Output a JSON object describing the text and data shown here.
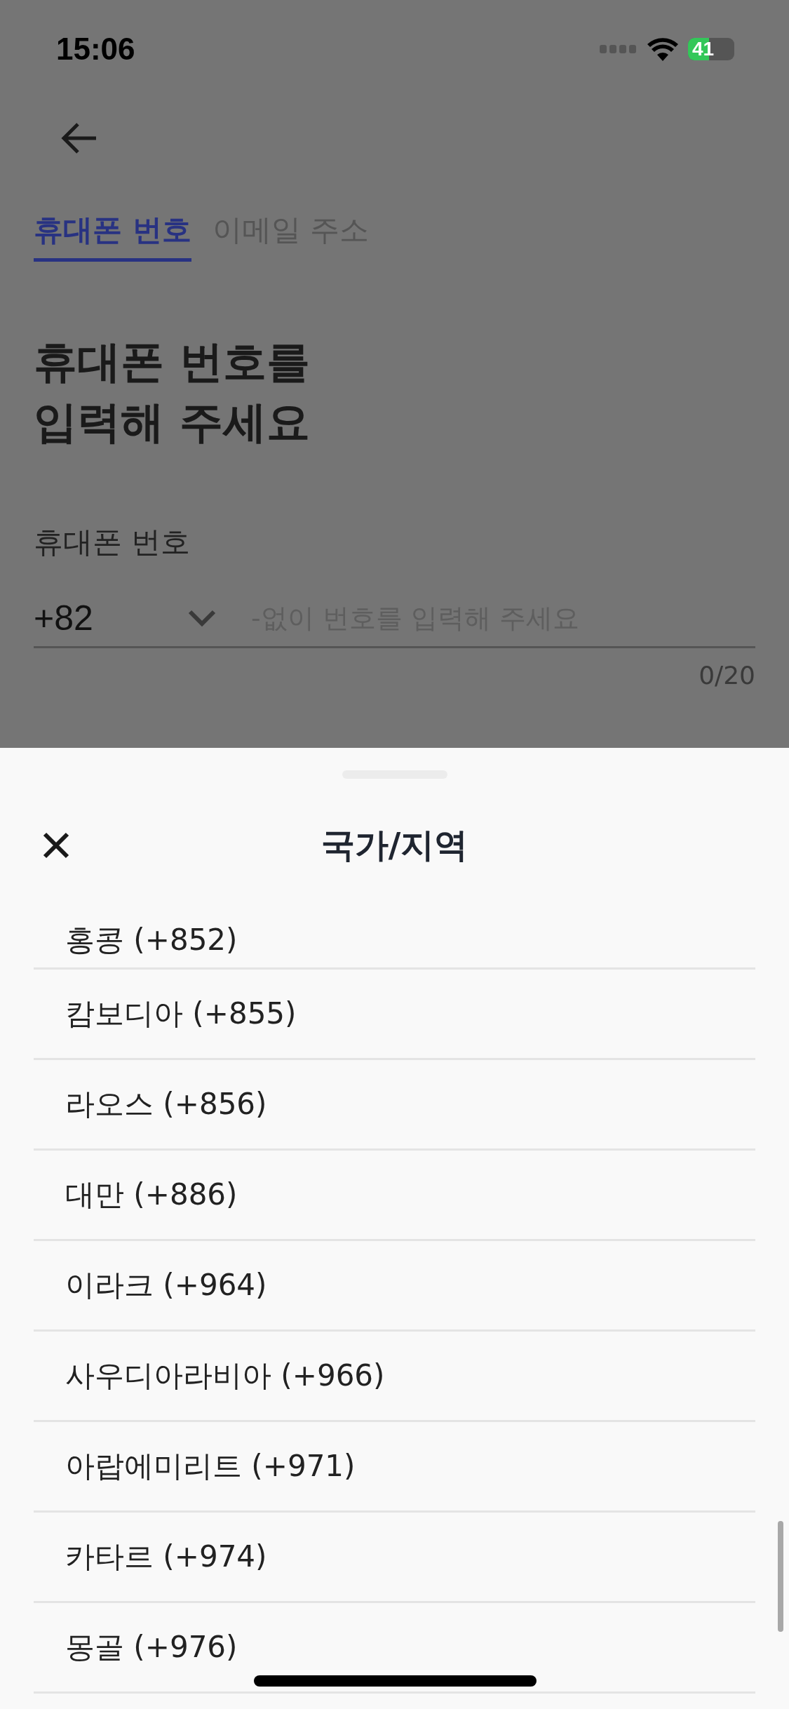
{
  "status_bar": {
    "time": "15:06",
    "battery": "41"
  },
  "tabs": [
    {
      "label": "휴대폰 번호",
      "selected": true
    },
    {
      "label": "이메일 주소",
      "selected": false
    }
  ],
  "heading": "휴대폰 번호를\n입력해 주세요",
  "phone_field": {
    "label": "휴대폰 번호",
    "country_code": "+82",
    "placeholder": "-없이 번호를 입력해 주세요",
    "counter": "0/20"
  },
  "sheet": {
    "title": "국가/지역",
    "items": [
      "홍콩 (+852)",
      "캄보디아 (+855)",
      "라오스 (+856)",
      "대만 (+886)",
      "이라크 (+964)",
      "사우디아라비아 (+966)",
      "아랍에미리트 (+971)",
      "카타르 (+974)",
      "몽골 (+976)"
    ]
  }
}
